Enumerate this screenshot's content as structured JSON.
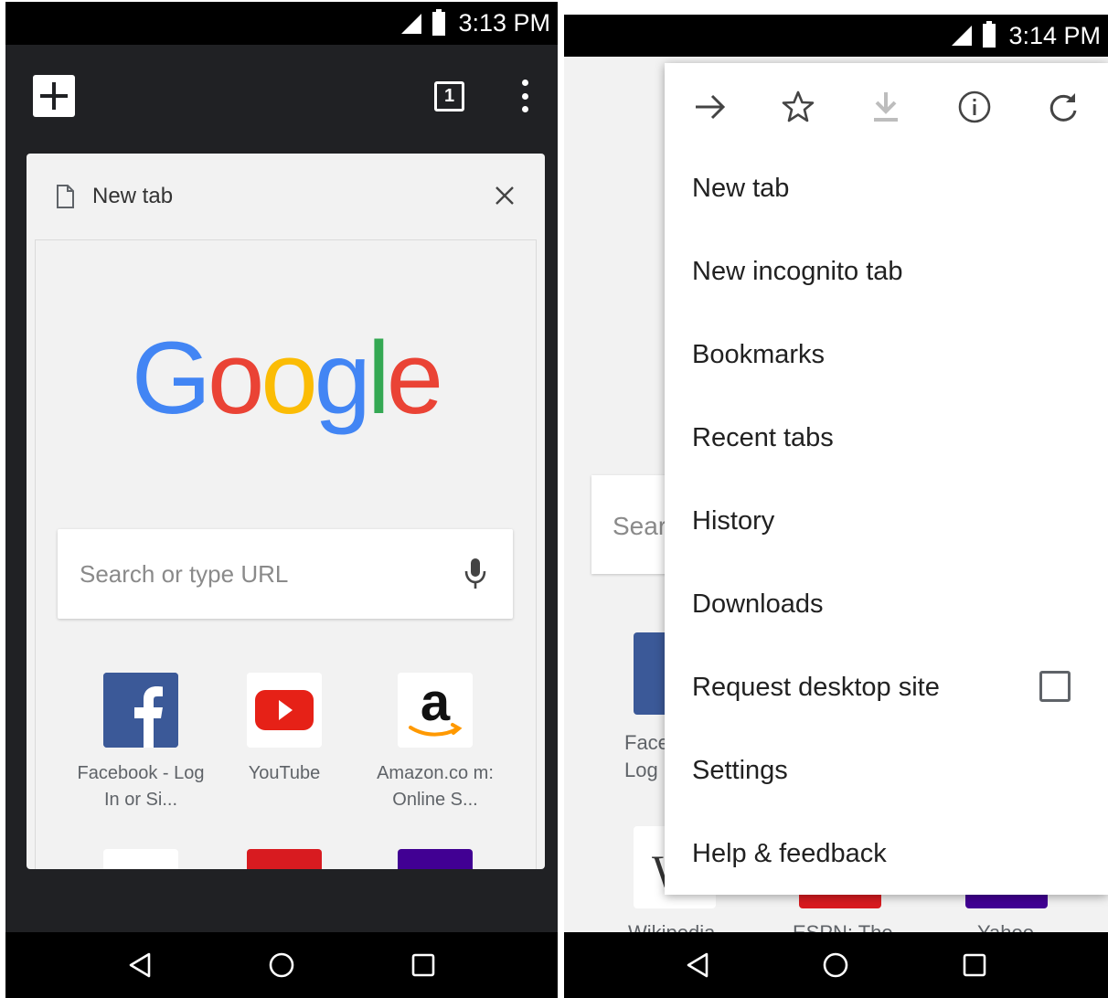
{
  "left_screen": {
    "status": {
      "time": "3:13 PM"
    },
    "toolbar": {
      "tab_count": "1"
    },
    "tab_card": {
      "title": "New tab",
      "search": {
        "placeholder": "Search or type URL"
      },
      "tiles": [
        {
          "label": "Facebook - Log In or Si...",
          "icon": "facebook-icon"
        },
        {
          "label": "YouTube",
          "icon": "youtube-icon"
        },
        {
          "label": "Amazon.co m: Online S...",
          "icon": "amazon-icon"
        }
      ],
      "logo": [
        "G",
        "o",
        "o",
        "g",
        "l",
        "e"
      ]
    }
  },
  "right_screen": {
    "status": {
      "time": "3:14 PM"
    },
    "background": {
      "search_partial": "Sear",
      "tile_label_partial": [
        "Face",
        "Log I"
      ],
      "bottom_labels": [
        "Wikipedia",
        "ESPN: The",
        "Yahoo"
      ]
    },
    "menu": {
      "actions": [
        "forward-icon",
        "bookmark-star-icon",
        "download-icon",
        "info-icon",
        "reload-icon"
      ],
      "items": [
        "New tab",
        "New incognito tab",
        "Bookmarks",
        "Recent tabs",
        "History",
        "Downloads",
        "Request desktop site",
        "Settings",
        "Help & feedback"
      ]
    }
  },
  "colors": {
    "google_blue": "#4285F4",
    "google_red": "#EA4335",
    "google_yellow": "#FBBC05",
    "google_green": "#34A853",
    "chrome_dark": "#202124",
    "facebook_blue": "#3B5998",
    "youtube_red": "#E62117",
    "yahoo_purple": "#410093"
  }
}
